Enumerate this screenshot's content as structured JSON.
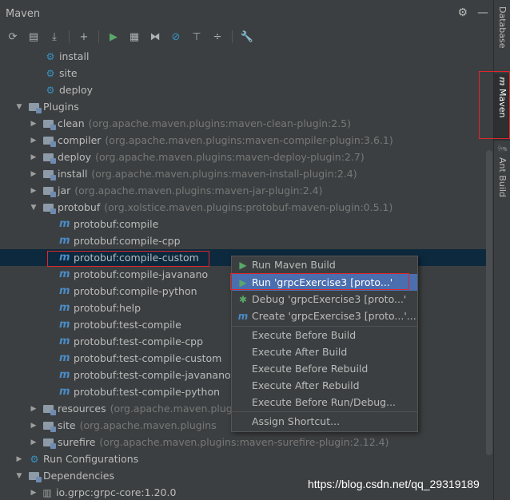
{
  "panel": {
    "title": "Maven"
  },
  "sidebar": {
    "tabs": [
      "Database",
      "Maven",
      "Ant Build"
    ]
  },
  "tree": {
    "lifecycle_items": [
      "install",
      "site",
      "deploy"
    ],
    "plugins_label": "Plugins",
    "plugins": [
      {
        "name": "clean",
        "artifact": "(org.apache.maven.plugins:maven-clean-plugin:2.5)"
      },
      {
        "name": "compiler",
        "artifact": "(org.apache.maven.plugins:maven-compiler-plugin:3.6.1)"
      },
      {
        "name": "deploy",
        "artifact": "(org.apache.maven.plugins:maven-deploy-plugin:2.7)"
      },
      {
        "name": "install",
        "artifact": "(org.apache.maven.plugins:maven-install-plugin:2.4)"
      },
      {
        "name": "jar",
        "artifact": "(org.apache.maven.plugins:maven-jar-plugin:2.4)"
      },
      {
        "name": "protobuf",
        "artifact": "(org.xolstice.maven.plugins:protobuf-maven-plugin:0.5.1)"
      }
    ],
    "goals": [
      "protobuf:compile",
      "protobuf:compile-cpp",
      "protobuf:compile-custom",
      "protobuf:compile-javanano",
      "protobuf:compile-python",
      "protobuf:help",
      "protobuf:test-compile",
      "protobuf:test-compile-cpp",
      "protobuf:test-compile-custom",
      "protobuf:test-compile-javanano",
      "protobuf:test-compile-python"
    ],
    "plugins_after": [
      {
        "name": "resources",
        "artifact": "(org.apache.maven.plugins"
      },
      {
        "name": "site",
        "artifact": "(org.apache.maven.plugins"
      },
      {
        "name": "surefire",
        "artifact": "(org.apache.maven.plugins:maven-surefire-plugin:2.12.4)"
      }
    ],
    "run_configurations": "Run Configurations",
    "dependencies": "Dependencies",
    "dependency_first": "io.grpc:grpc-core:1.20.0"
  },
  "context_menu": {
    "items": [
      {
        "label": "Run Maven Build",
        "icon": "run-icon"
      },
      {
        "label": "Run 'grpcExercise3 [proto...'",
        "icon": "run-icon"
      },
      {
        "label": "Debug 'grpcExercise3 [proto...'",
        "icon": "debug-icon"
      },
      {
        "label": "Create 'grpcExercise3 [proto...'...",
        "icon": "maven-icon"
      },
      {
        "label": "Execute Before Build"
      },
      {
        "label": "Execute After Build"
      },
      {
        "label": "Execute Before Rebuild"
      },
      {
        "label": "Execute After Rebuild"
      },
      {
        "label": "Execute Before Run/Debug..."
      },
      {
        "label": "Assign Shortcut..."
      }
    ]
  },
  "watermark": "https://blog.csdn.net/qq_29319189"
}
